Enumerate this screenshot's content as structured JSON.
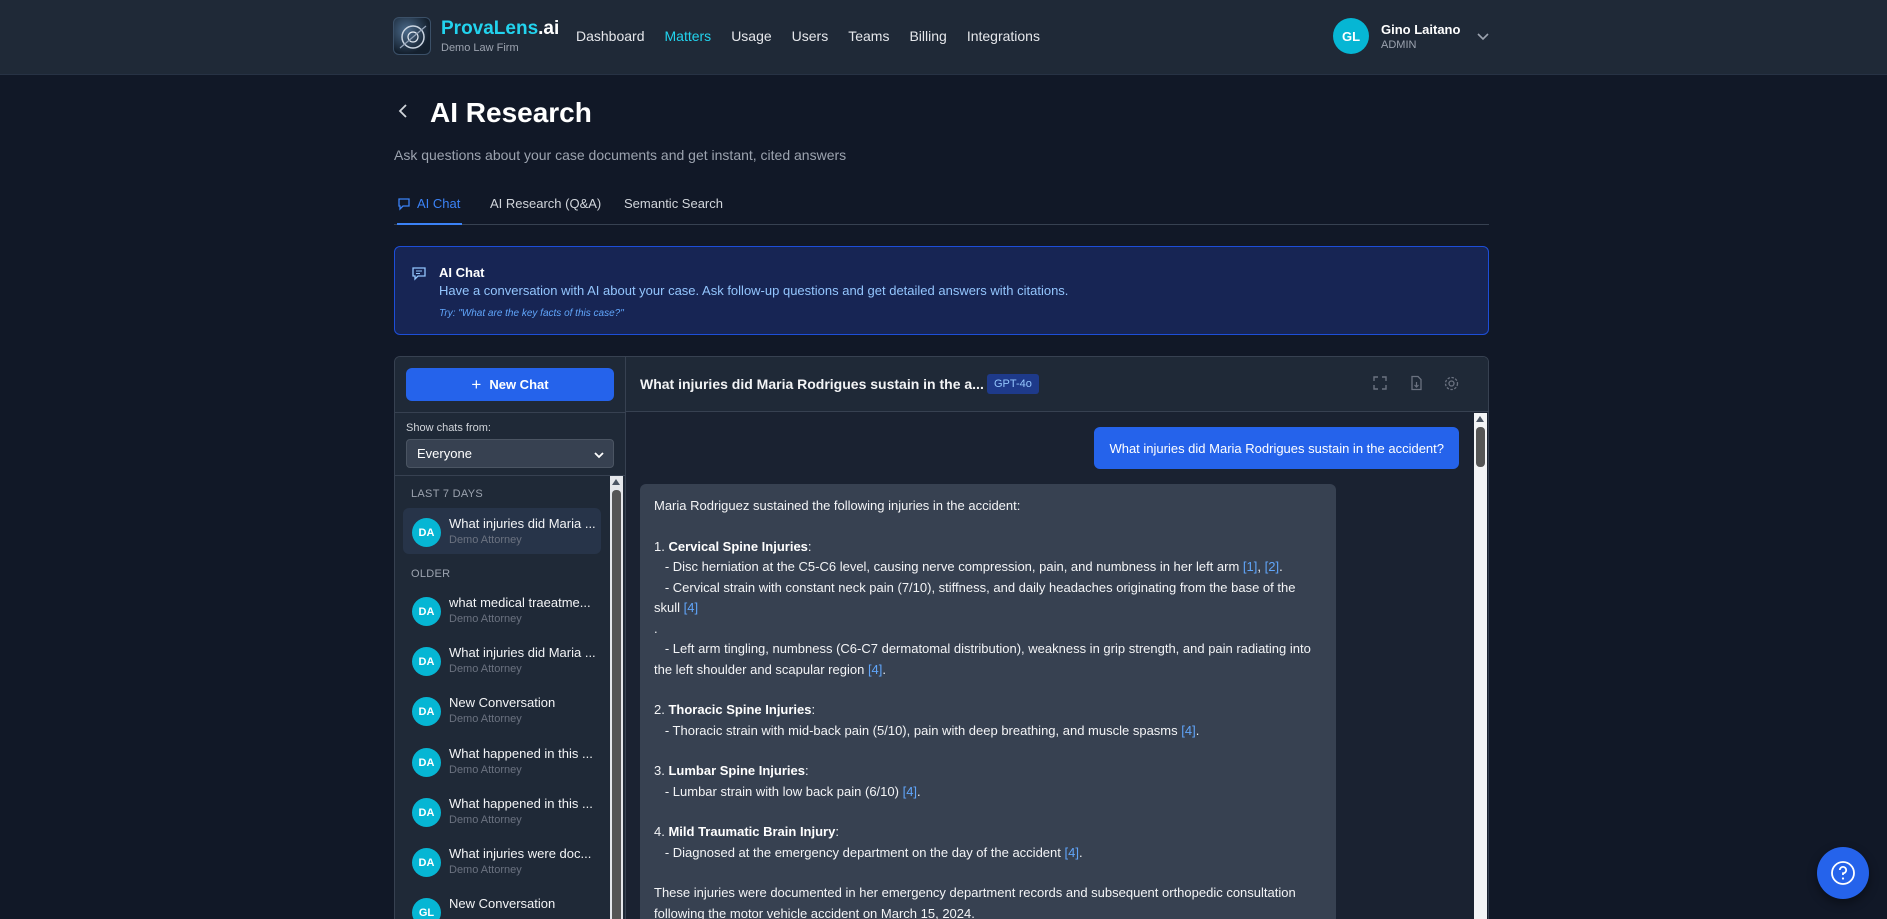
{
  "brand": {
    "name": "ProvaLens",
    "name_suffix": ".ai",
    "subtitle": "Demo Law Firm"
  },
  "nav": {
    "items": [
      {
        "label": "Dashboard",
        "active": false
      },
      {
        "label": "Matters",
        "active": true
      },
      {
        "label": "Usage",
        "active": false
      },
      {
        "label": "Users",
        "active": false
      },
      {
        "label": "Teams",
        "active": false
      },
      {
        "label": "Billing",
        "active": false
      },
      {
        "label": "Integrations",
        "active": false
      }
    ]
  },
  "user": {
    "initials": "GL",
    "name": "Gino Laitano",
    "role": "ADMIN"
  },
  "page": {
    "title": "AI Research",
    "subtitle": "Ask questions about your case documents and get instant, cited answers"
  },
  "tabs": [
    {
      "label": "AI Chat",
      "active": true
    },
    {
      "label": "AI Research (Q&A)",
      "active": false
    },
    {
      "label": "Semantic Search",
      "active": false
    }
  ],
  "banner": {
    "title": "AI Chat",
    "description": "Have a conversation with AI about your case. Ask follow-up questions and get detailed answers with citations.",
    "try_text": "Try: \"What are the key facts of this case?\""
  },
  "sidebar": {
    "new_chat_label": "New Chat",
    "show_label": "Show chats from:",
    "filter_value": "Everyone",
    "groups": [
      {
        "label": "LAST 7 DAYS",
        "items": [
          {
            "initials": "DA",
            "title": "What injuries did Maria ...",
            "author": "Demo Attorney",
            "active": true
          }
        ]
      },
      {
        "label": "OLDER",
        "items": [
          {
            "initials": "DA",
            "title": "what medical traeatme...",
            "author": "Demo Attorney",
            "active": false
          },
          {
            "initials": "DA",
            "title": "What injuries did Maria ...",
            "author": "Demo Attorney",
            "active": false
          },
          {
            "initials": "DA",
            "title": "New Conversation",
            "author": "Demo Attorney",
            "active": false
          },
          {
            "initials": "DA",
            "title": "What happened in this ...",
            "author": "Demo Attorney",
            "active": false
          },
          {
            "initials": "DA",
            "title": "What happened in this ...",
            "author": "Demo Attorney",
            "active": false
          },
          {
            "initials": "DA",
            "title": "What injuries were doc...",
            "author": "Demo Attorney",
            "active": false
          },
          {
            "initials": "GL",
            "title": "New Conversation",
            "author": "",
            "active": false
          }
        ]
      }
    ]
  },
  "chat": {
    "title": "What injuries did Maria Rodrigues sustain in the a...",
    "model": "GPT-4o",
    "user_message": "What injuries did Maria Rodrigues sustain in the accident?",
    "ai": {
      "intro": "Maria Rodriguez sustained the following injuries in the accident:",
      "s1_num": "1.",
      "s1_title": "Cervical Spine Injuries",
      "s1_l1": "- Disc herniation at the C5-C6 level, causing nerve compression, pain, and numbness in her left arm",
      "s1_l1_c1": "[1]",
      "s1_l1_c2": "[2]",
      "s1_l2": "- Cervical strain with constant neck pain (7/10), stiffness, and daily headaches originating from the base of the skull",
      "s1_l2_c": "[4]",
      "s1_l3": "- Left arm tingling, numbness (C6-C7 dermatomal distribution), weakness in grip strength, and pain radiating into the left shoulder and scapular region",
      "s1_l3_c": "[4]",
      "s2_num": "2.",
      "s2_title": "Thoracic Spine Injuries",
      "s2_l1": "- Thoracic strain with mid-back pain (5/10), pain with deep breathing, and muscle spasms",
      "s2_l1_c": "[4]",
      "s3_num": "3.",
      "s3_title": "Lumbar Spine Injuries",
      "s3_l1": "- Lumbar strain with low back pain (6/10)",
      "s3_l1_c": "[4]",
      "s4_num": "4.",
      "s4_title": "Mild Traumatic Brain Injury",
      "s4_l1": "- Diagnosed at the emergency department on the day of the accident",
      "s4_l1_c": "[4]",
      "summary": "These injuries were documented in her emergency department records and subsequent orthopedic consultation following the motor vehicle accident on March 15, 2024."
    }
  },
  "colors": {
    "accent": "#2563eb",
    "brand": "#22d3ee",
    "avatar": "#06b6d4"
  }
}
